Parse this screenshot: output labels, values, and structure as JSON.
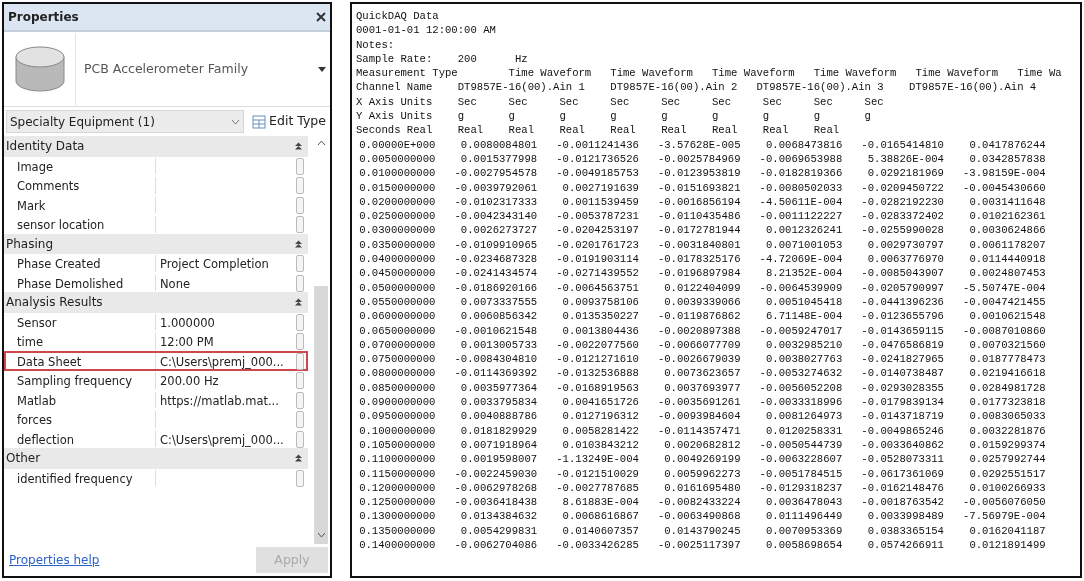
{
  "properties": {
    "title": "Properties",
    "type_name": "PCB Accelerometer Family",
    "category": "Specialty Equipment (1)",
    "edit_type": "Edit Type",
    "groups": [
      {
        "name": "Identity Data",
        "expanded": true,
        "rows": [
          {
            "label": "Image",
            "highlighted": false
          },
          {
            "label": "Comments",
            "highlighted": false
          },
          {
            "label": "Mark",
            "highlighted": false
          },
          {
            "label": "sensor location",
            "highlighted": false
          }
        ]
      },
      {
        "name": "Phasing",
        "expanded": true,
        "rows": [
          {
            "label": "Phase Created",
            "value": "Project Completion",
            "highlighted": false
          },
          {
            "label": "Phase Demolished",
            "value": "None",
            "highlighted": false
          }
        ]
      },
      {
        "name": "Analysis Results",
        "expanded": true,
        "rows": [
          {
            "label": "Sensor",
            "value": "1.000000",
            "highlighted": false
          },
          {
            "label": "time",
            "value": "12:00 PM",
            "highlighted": false
          },
          {
            "label": "Data Sheet",
            "value": "C:\\Users\\premj_000...",
            "highlighted": true
          },
          {
            "label": "Sampling frequency",
            "value": "200.00 Hz",
            "highlighted": false
          },
          {
            "label": "Matlab",
            "value": "https://matlab.mat...",
            "highlighted": false
          },
          {
            "label": "forces",
            "highlighted": false
          },
          {
            "label": "deflection",
            "value": "C:\\Users\\premj_000...",
            "highlighted": false
          }
        ]
      },
      {
        "name": "Other",
        "expanded": true,
        "rows": [
          {
            "label": "identified frequency",
            "highlighted": false
          }
        ]
      }
    ],
    "help_link": "Properties help",
    "apply": {
      "label": "Apply",
      "disabled": true
    }
  },
  "data_file": {
    "header_lines": [
      "QuickDAQ Data",
      "0001-01-01 12:00:00 AM",
      "Notes:",
      "Sample Rate:    200      Hz",
      "Measurement Type        Time Waveform   Time Waveform   Time Waveform   Time Waveform   Time Waveform   Time Wa",
      "Channel Name    DT9857E-16(00).Ain 1    DT9857E-16(00).Ain 2   DT9857E-16(00).Ain 3    DT9857E-16(00).Ain 4",
      "X Axis Units    Sec     Sec     Sec     Sec     Sec     Sec     Sec     Sec     Sec",
      "Y Axis Units    g       g       g       g       g       g       g       g       g",
      "Seconds Real    Real    Real    Real    Real    Real    Real    Real    Real"
    ],
    "rows": [
      [
        "0.00000E+000",
        "0.0080084801",
        "-0.0011241436",
        "-3.57628E-005",
        "0.0068473816",
        "-0.0165414810",
        "0.0417876244"
      ],
      [
        "0.0050000000",
        "0.0015377998",
        "-0.0121736526",
        "-0.0025784969",
        "-0.0069653988",
        "5.38826E-004",
        "0.0342857838"
      ],
      [
        "0.0100000000",
        "-0.0027954578",
        "-0.0049185753",
        "-0.0123953819",
        "-0.0182819366",
        "0.0292181969",
        "-3.98159E-004"
      ],
      [
        "0.0150000000",
        "-0.0039792061",
        "0.0027191639",
        "-0.0151693821",
        "-0.0080502033",
        "-0.0209450722",
        "-0.0045430660"
      ],
      [
        "0.0200000000",
        "-0.0102317333",
        "0.0011539459",
        "-0.0016856194",
        "-4.50611E-004",
        "-0.0282192230",
        "0.0031411648"
      ],
      [
        "0.0250000000",
        "-0.0042343140",
        "-0.0053787231",
        "-0.0110435486",
        "-0.0011122227",
        "-0.0283372402",
        "0.0102162361"
      ],
      [
        "0.0300000000",
        "0.0026273727",
        "-0.0204253197",
        "-0.0172781944",
        "0.0012326241",
        "-0.0255990028",
        "0.0030624866"
      ],
      [
        "0.0350000000",
        "-0.0109910965",
        "-0.0201761723",
        "-0.0031840801",
        "0.0071001053",
        "0.0029730797",
        "0.0061178207"
      ],
      [
        "0.0400000000",
        "-0.0234687328",
        "-0.0191903114",
        "-0.0178325176",
        "-4.72069E-004",
        "0.0063776970",
        "0.0114440918"
      ],
      [
        "0.0450000000",
        "-0.0241434574",
        "-0.0271439552",
        "-0.0196897984",
        "8.21352E-004",
        "-0.0085043907",
        "0.0024807453"
      ],
      [
        "0.0500000000",
        "-0.0186920166",
        "-0.0064563751",
        "0.0122404099",
        "-0.0064539909",
        "-0.0205790997",
        "-5.50747E-004"
      ],
      [
        "0.0550000000",
        "0.0073337555",
        "0.0093758106",
        "0.0039339066",
        "0.0051045418",
        "-0.0441396236",
        "-0.0047421455"
      ],
      [
        "0.0600000000",
        "0.0060856342",
        "0.0135350227",
        "-0.0119876862",
        "6.71148E-004",
        "-0.0123655796",
        "0.0010621548"
      ],
      [
        "0.0650000000",
        "-0.0010621548",
        "0.0013804436",
        "-0.0020897388",
        "-0.0059247017",
        "-0.0143659115",
        "-0.0087010860"
      ],
      [
        "0.0700000000",
        "0.0013005733",
        "-0.0022077560",
        "-0.0066077709",
        "0.0032985210",
        "-0.0476586819",
        "0.0070321560"
      ],
      [
        "0.0750000000",
        "-0.0084304810",
        "-0.0121271610",
        "-0.0026679039",
        "0.0038027763",
        "-0.0241827965",
        "0.0187778473"
      ],
      [
        "0.0800000000",
        "-0.0114369392",
        "-0.0132536888",
        "0.0073623657",
        "-0.0053274632",
        "-0.0140738487",
        "0.0219416618"
      ],
      [
        "0.0850000000",
        "0.0035977364",
        "-0.0168919563",
        "0.0037693977",
        "-0.0056052208",
        "-0.0293028355",
        "0.0284981728"
      ],
      [
        "0.0900000000",
        "0.0033795834",
        "0.0041651726",
        "-0.0035691261",
        "-0.0033318996",
        "-0.0179839134",
        "0.0177323818"
      ],
      [
        "0.0950000000",
        "0.0040888786",
        "0.0127196312",
        "-0.0093984604",
        "0.0081264973",
        "-0.0143718719",
        "0.0083065033"
      ],
      [
        "0.1000000000",
        "0.0181829929",
        "0.0058281422",
        "-0.0114357471",
        "0.0120258331",
        "-0.0049865246",
        "0.0032281876"
      ],
      [
        "0.1050000000",
        "0.0071918964",
        "0.0103843212",
        "0.0020682812",
        "-0.0050544739",
        "-0.0033640862",
        "0.0159299374"
      ],
      [
        "0.1100000000",
        "0.0019598007",
        "-1.13249E-004",
        "0.0049269199",
        "-0.0063228607",
        "-0.0528073311",
        "0.0257992744"
      ],
      [
        "0.1150000000",
        "-0.0022459030",
        "-0.0121510029",
        "0.0059962273",
        "-0.0051784515",
        "-0.0617361069",
        "0.0292551517"
      ],
      [
        "0.1200000000",
        "-0.0062978268",
        "-0.0027787685",
        "0.0161695480",
        "-0.0129318237",
        "-0.0162148476",
        "0.0100266933"
      ],
      [
        "0.1250000000",
        "-0.0036418438",
        "8.61883E-004",
        "-0.0082433224",
        "0.0036478043",
        "-0.0018763542",
        "-0.0056076050"
      ],
      [
        "0.1300000000",
        "0.0134384632",
        "0.0068616867",
        "-0.0063490868",
        "0.0111496449",
        "0.0033998489",
        "-7.56979E-004"
      ],
      [
        "0.1350000000",
        "0.0054299831",
        "0.0140607357",
        "0.0143790245",
        "0.0070953369",
        "0.0383365154",
        "0.0162041187"
      ],
      [
        "0.1400000000",
        "-0.0062704086",
        "-0.0033426285",
        "-0.0025117397",
        "0.0058698654",
        "0.0574266911",
        "0.0121891499"
      ]
    ]
  }
}
